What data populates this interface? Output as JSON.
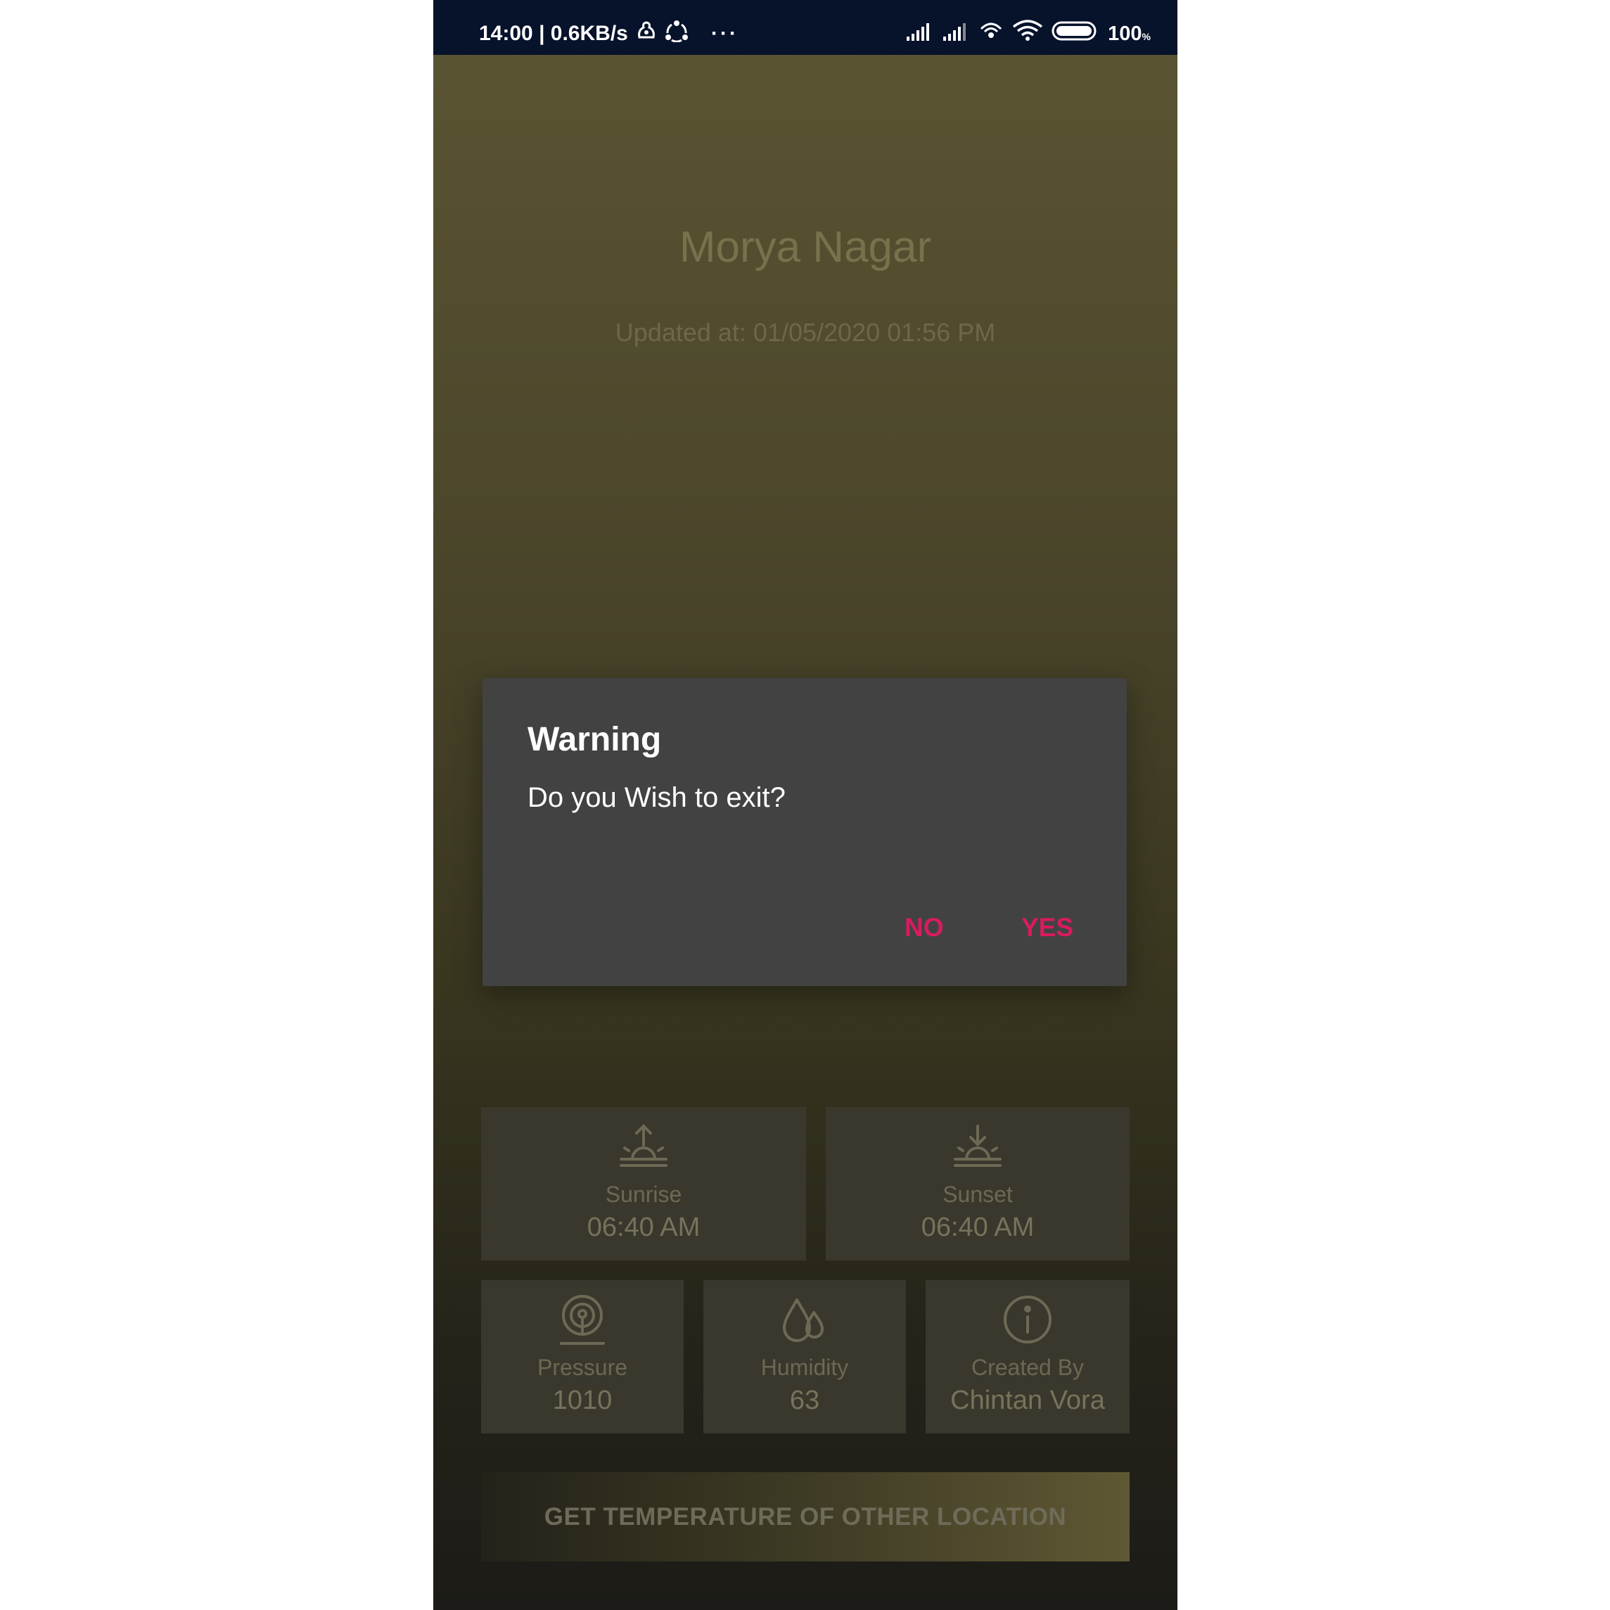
{
  "status_bar": {
    "time_speed": "14:00 | 0.6KB/s",
    "more": "···",
    "battery": "100",
    "battery_unit": "%",
    "icons": [
      "notification-icon",
      "sync-icon",
      "signal-icon",
      "signal-icon",
      "hotspot-icon",
      "wifi-icon",
      "battery-icon"
    ]
  },
  "weather": {
    "city": "Morya Nagar",
    "updated": "Updated at: 01/05/2020 01:56 PM"
  },
  "tiles": {
    "sunrise": {
      "label": "Sunrise",
      "value": "06:40 AM",
      "icon": "sunrise-icon"
    },
    "sunset": {
      "label": "Sunset",
      "value": "06:40 AM",
      "icon": "sunset-icon"
    },
    "pressure": {
      "label": "Pressure",
      "value": "1010",
      "icon": "pressure-icon"
    },
    "humidity": {
      "label": "Humidity",
      "value": "63",
      "icon": "humidity-icon"
    },
    "created": {
      "label": "Created By",
      "value": "Chintan Vora",
      "icon": "info-icon"
    }
  },
  "cta": {
    "label": "GET TEMPERATURE OF OTHER LOCATION"
  },
  "dialog": {
    "title": "Warning",
    "message": "Do you Wish to exit?",
    "no_label": "NO",
    "yes_label": "YES"
  },
  "colors": {
    "accent": "#d81b60",
    "dialog_bg": "#424242",
    "status_bar_bg": "#07122b"
  }
}
